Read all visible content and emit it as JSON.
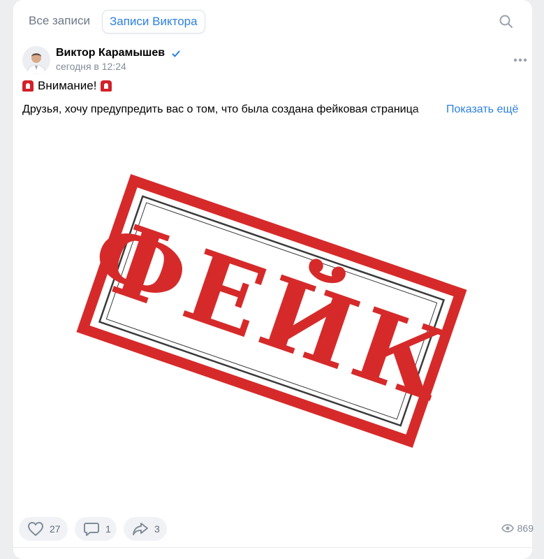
{
  "tabs": {
    "all": "Все записи",
    "author": "Записи Виктора"
  },
  "post": {
    "author": "Виктор Карамышев",
    "time": "сегодня в 12:24",
    "headline": "Внимание!",
    "text": "Друзья, хочу предупредить вас о том, что была создана фейковая страница",
    "show_more": "Показать ещё",
    "image_text": "ФЕЙК",
    "likes": "27",
    "comments": "1",
    "reposts": "3",
    "views": "869"
  },
  "icons": {
    "search": "search-icon",
    "verified": "verified-check-icon",
    "more": "more-dots-icon",
    "siren": "siren-emoji-icon",
    "like": "heart-icon",
    "comment": "comment-icon",
    "share": "share-icon",
    "views": "eye-icon"
  },
  "colors": {
    "accent": "#2d81e0",
    "stamp": "#d62a2a",
    "muted": "#818c99"
  }
}
